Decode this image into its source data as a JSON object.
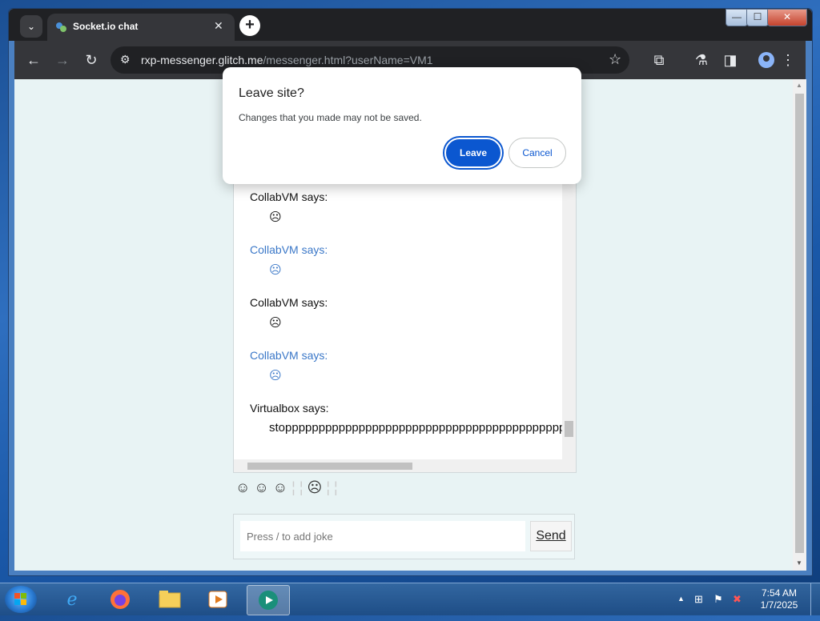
{
  "browser": {
    "tab_title": "Socket.io chat",
    "tab_close": "✕",
    "new_tab": "+",
    "url_host": "rxp-messenger.glitch.me",
    "url_path": "/messenger.html?userName=VM1"
  },
  "window_controls": {
    "minimize": "—",
    "maximize": "☐",
    "close": "✕"
  },
  "chat": {
    "messages": [
      {
        "name": "CollabVM says:",
        "body": "☹",
        "color": "black"
      },
      {
        "name": "CollabVM says:",
        "body": "☹",
        "color": "blue"
      },
      {
        "name": "CollabVM says:",
        "body": "☹",
        "color": "black"
      },
      {
        "name": "CollabVM says:",
        "body": "☹",
        "color": "blue"
      },
      {
        "name": "Virtualbox says:",
        "body": "stopppppppppppppppppppppppppppppppppppppppppppp",
        "color": "black"
      }
    ]
  },
  "emoji_bar": [
    "☺",
    "☺",
    "☺",
    "¦",
    "¦",
    "☹",
    "¦",
    "¦"
  ],
  "input": {
    "placeholder": "Press / to add joke",
    "send_label": "Send"
  },
  "dialog": {
    "title": "Leave site?",
    "message": "Changes that you made may not be saved.",
    "leave_label": "Leave",
    "cancel_label": "Cancel"
  },
  "taskbar": {
    "time": "7:54 AM",
    "date": "1/7/2025"
  }
}
